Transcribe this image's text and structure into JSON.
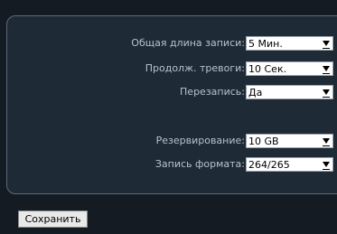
{
  "settings": {
    "rows": [
      {
        "label": "Общая длина записи:",
        "value": "5 Мин."
      },
      {
        "label": "Продолж. тревоги:",
        "value": "10 Сек."
      },
      {
        "label": "Перезапись:",
        "value": "Да"
      },
      {
        "label": "Резервирование:",
        "value": "10 GB"
      },
      {
        "label": "Запись формата:",
        "value": "264/265"
      }
    ]
  },
  "actions": {
    "save_label": "Сохранить"
  },
  "icons": {
    "dropdown": "chevron-down-icon"
  },
  "colors": {
    "background": "#151b22",
    "panel": "#1e2a36",
    "panel_border": "#5b6a7a",
    "label_text": "#b9c2cb"
  }
}
